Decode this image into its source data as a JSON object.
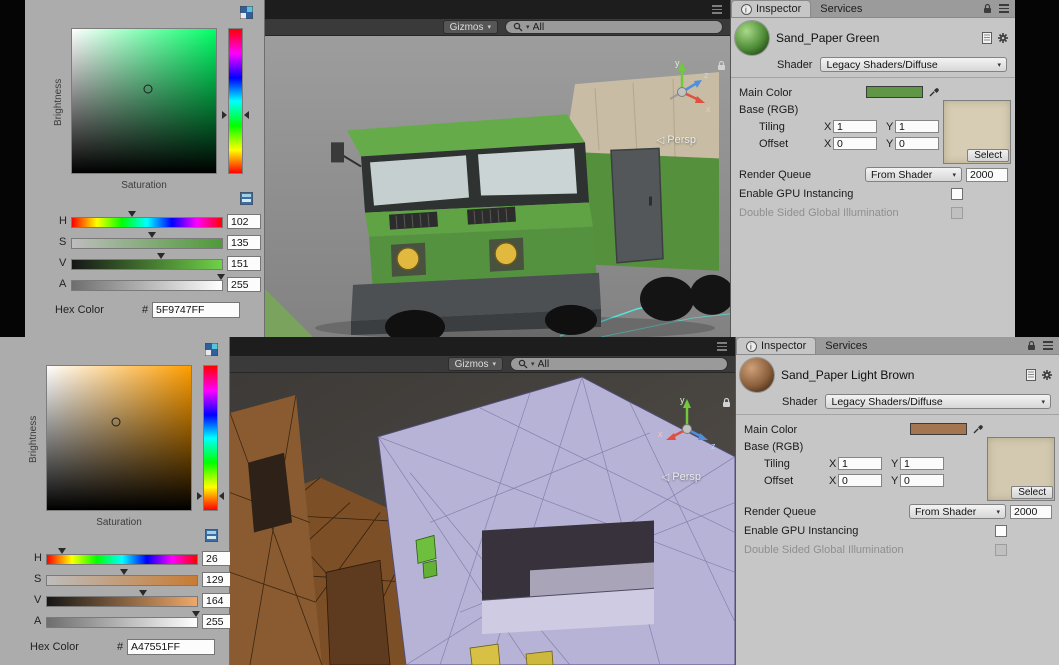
{
  "colors": {
    "top_material": "#5F9747",
    "bottom_material": "#A47551",
    "hue_green_hex": "5F9747FF",
    "hue_brown_hex": "A47551FF"
  },
  "top": {
    "picker": {
      "brightness_label": "Brightness",
      "saturation_label": "Saturation",
      "sliders": [
        {
          "label": "H",
          "value": "102"
        },
        {
          "label": "S",
          "value": "135"
        },
        {
          "label": "V",
          "value": "151"
        },
        {
          "label": "A",
          "value": "255"
        }
      ],
      "hex_label": "Hex Color",
      "hex_prefix": "#",
      "hex_value": "5F9747FF"
    },
    "scene": {
      "gizmos_label": "Gizmos",
      "search_value": "All",
      "persp_label": "Persp",
      "axis_x": "x",
      "axis_y": "y",
      "axis_z": "z"
    },
    "inspector": {
      "tab_inspector": "Inspector",
      "tab_services": "Services",
      "material_name": "Sand_Paper Green",
      "shader_label": "Shader",
      "shader_value": "Legacy Shaders/Diffuse",
      "main_color_label": "Main Color",
      "base_label": "Base (RGB)",
      "select_label": "Select",
      "tiling_label": "Tiling",
      "offset_label": "Offset",
      "x_label": "X",
      "y_label": "Y",
      "tiling_x": "1",
      "tiling_y": "1",
      "offset_x": "0",
      "offset_y": "0",
      "render_queue_label": "Render Queue",
      "render_queue_mode": "From Shader",
      "render_queue_value": "2000",
      "gpu_instancing_label": "Enable GPU Instancing",
      "double_sided_gi_label": "Double Sided Global Illumination"
    }
  },
  "bottom": {
    "picker": {
      "brightness_label": "Brightness",
      "saturation_label": "Saturation",
      "sliders": [
        {
          "label": "H",
          "value": "26"
        },
        {
          "label": "S",
          "value": "129"
        },
        {
          "label": "V",
          "value": "164"
        },
        {
          "label": "A",
          "value": "255"
        }
      ],
      "hex_label": "Hex Color",
      "hex_prefix": "#",
      "hex_value": "A47551FF"
    },
    "scene": {
      "gizmos_label": "Gizmos",
      "search_value": "All",
      "persp_label": "Persp",
      "axis_x": "x",
      "axis_y": "y",
      "axis_z": "z"
    },
    "inspector": {
      "tab_inspector": "Inspector",
      "tab_services": "Services",
      "material_name": "Sand_Paper Light Brown",
      "shader_label": "Shader",
      "shader_value": "Legacy Shaders/Diffuse",
      "main_color_label": "Main Color",
      "base_label": "Base (RGB)",
      "select_label": "Select",
      "tiling_label": "Tiling",
      "offset_label": "Offset",
      "x_label": "X",
      "y_label": "Y",
      "tiling_x": "1",
      "tiling_y": "1",
      "offset_x": "0",
      "offset_y": "0",
      "render_queue_label": "Render Queue",
      "render_queue_mode": "From Shader",
      "render_queue_value": "2000",
      "gpu_instancing_label": "Enable GPU Instancing",
      "double_sided_gi_label": "Double Sided Global Illumination"
    }
  }
}
